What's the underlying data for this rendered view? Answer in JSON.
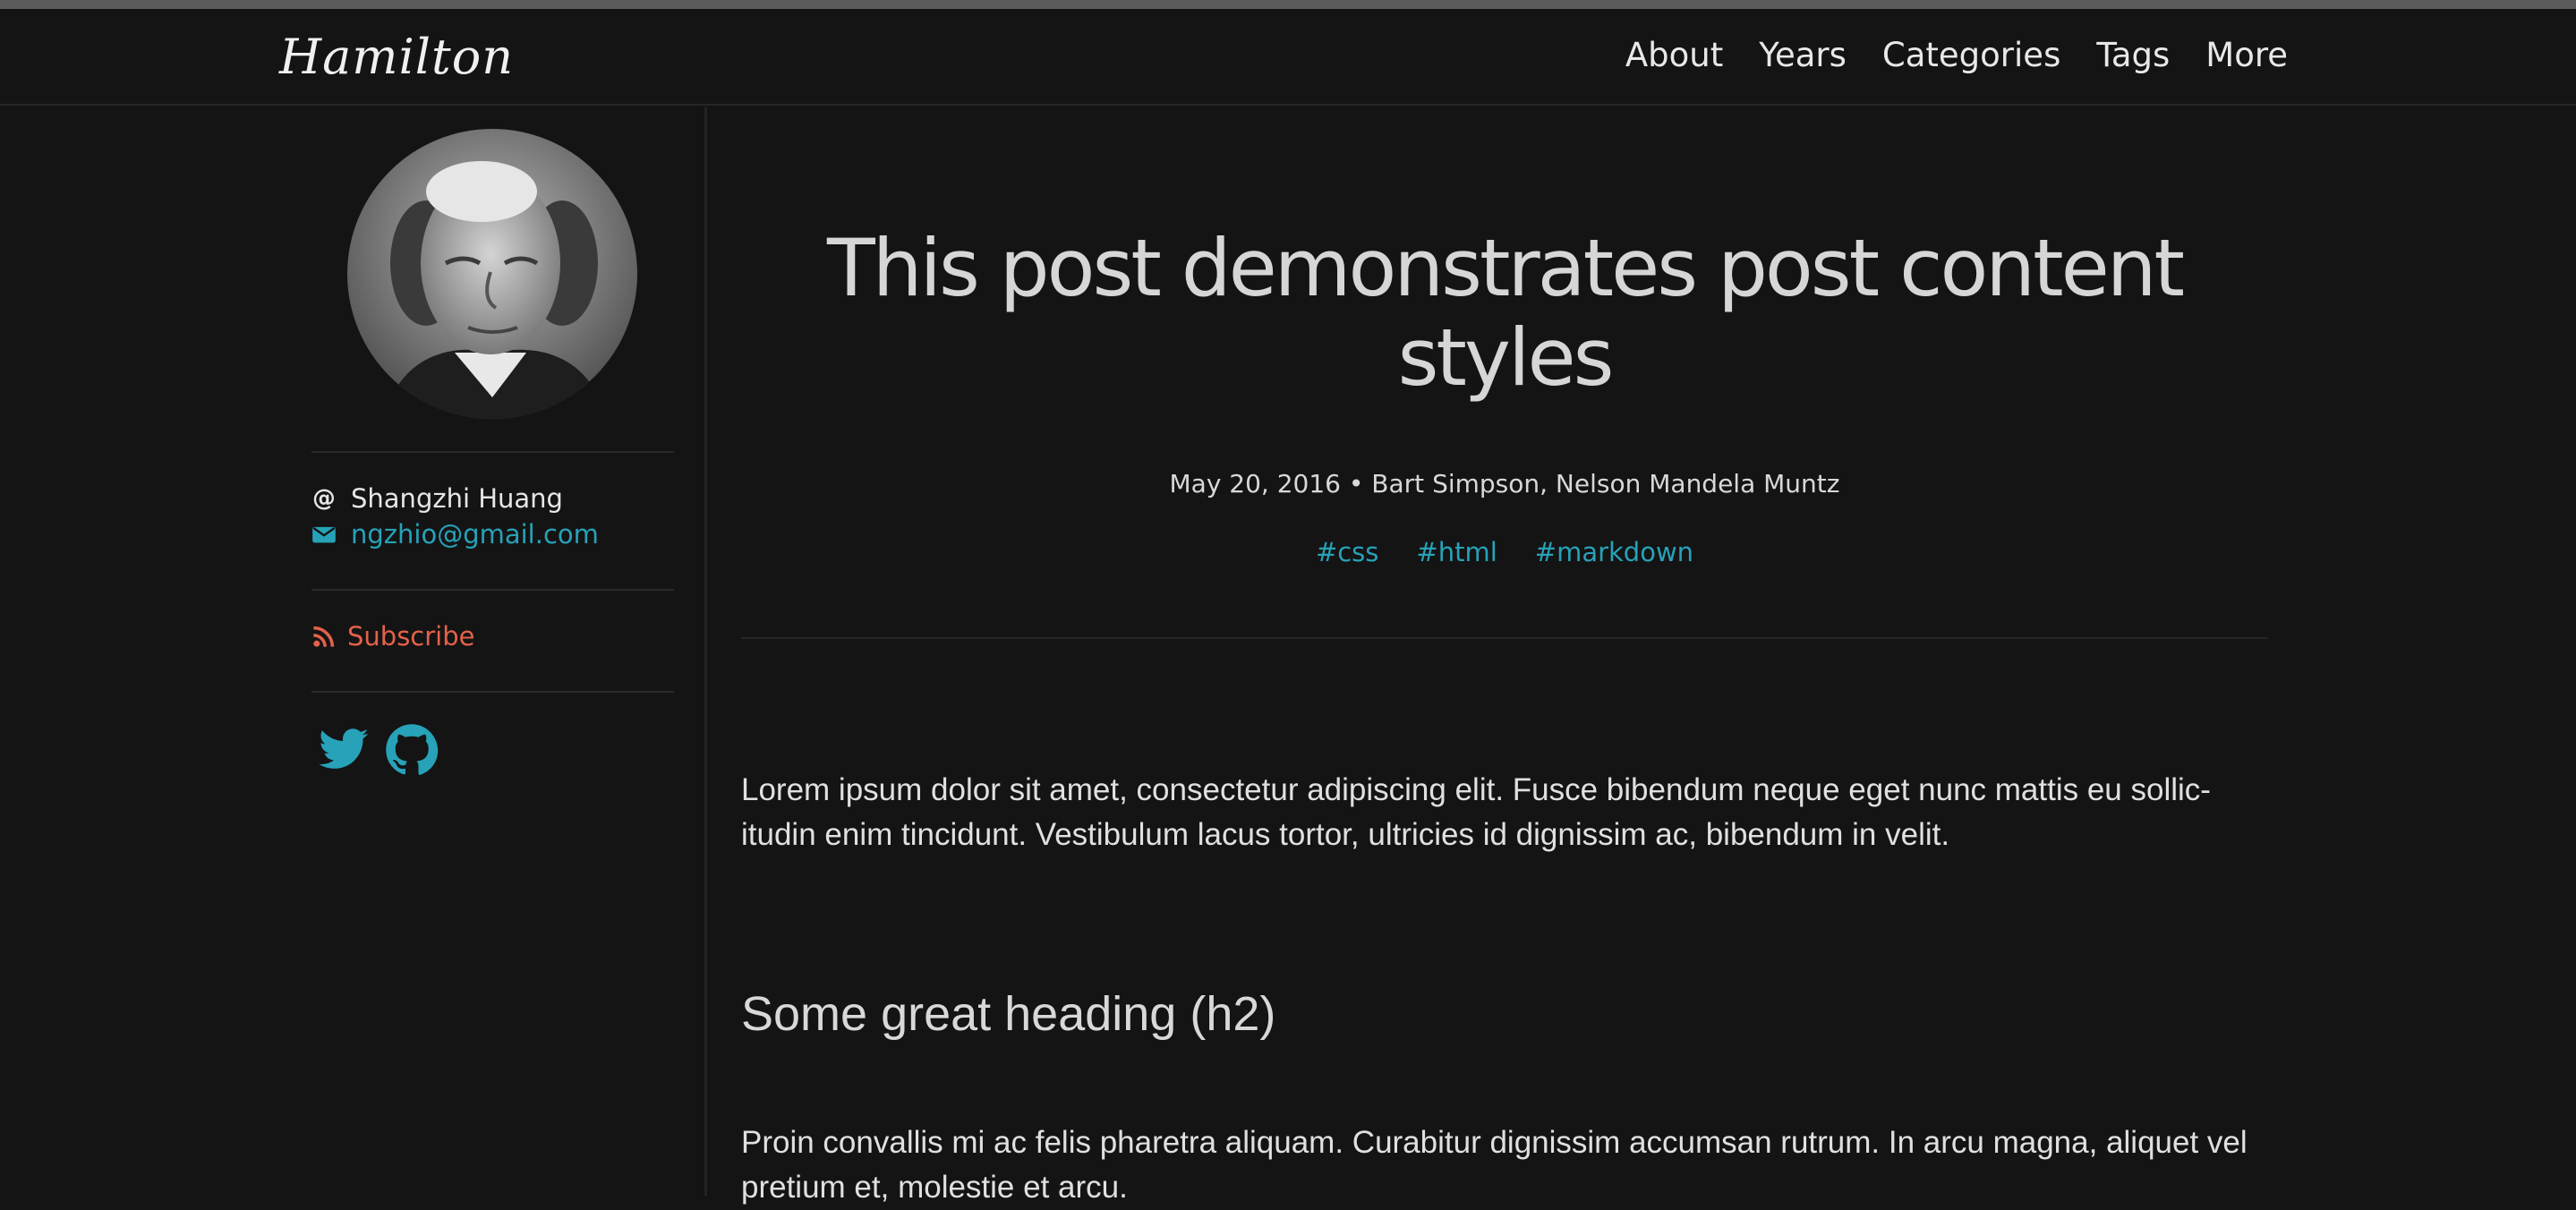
{
  "navbar": {
    "logo": "Hamilton",
    "links": [
      "About",
      "Years",
      "Categories",
      "Tags",
      "More"
    ]
  },
  "sidebar": {
    "author_name": "Shangzhi Huang",
    "email": "ngzhio@gmail.com",
    "subscribe_label": "Subscribe",
    "social_icons": [
      "twitter-icon",
      "github-icon"
    ]
  },
  "post": {
    "title": "This post demonstrates post content styles",
    "meta": "May 20, 2016 • Bart Simpson, Nelson Mandela Muntz",
    "tags": [
      "#css",
      "#html",
      "#markdown"
    ],
    "paragraph_1": "Lorem ipsum dolor sit amet, consectetur adipiscing elit. Fusce bibendum neque eget nunc mattis eu sollic-itudin enim tincidunt. Vestibulum lacus tortor, ultricies id dignissim ac, bibendum in velit.",
    "heading_2": "Some great heading (h2)",
    "paragraph_2": "Proin convallis mi ac felis pharetra aliquam. Curabitur dignissim accumsan rutrum. In arcu magna, aliquet vel pretium et, molestie et arcu."
  },
  "colors": {
    "background": "#141414",
    "link": "#27a2b8",
    "subscribe": "#e4624a",
    "text": "#dcdcdc"
  }
}
